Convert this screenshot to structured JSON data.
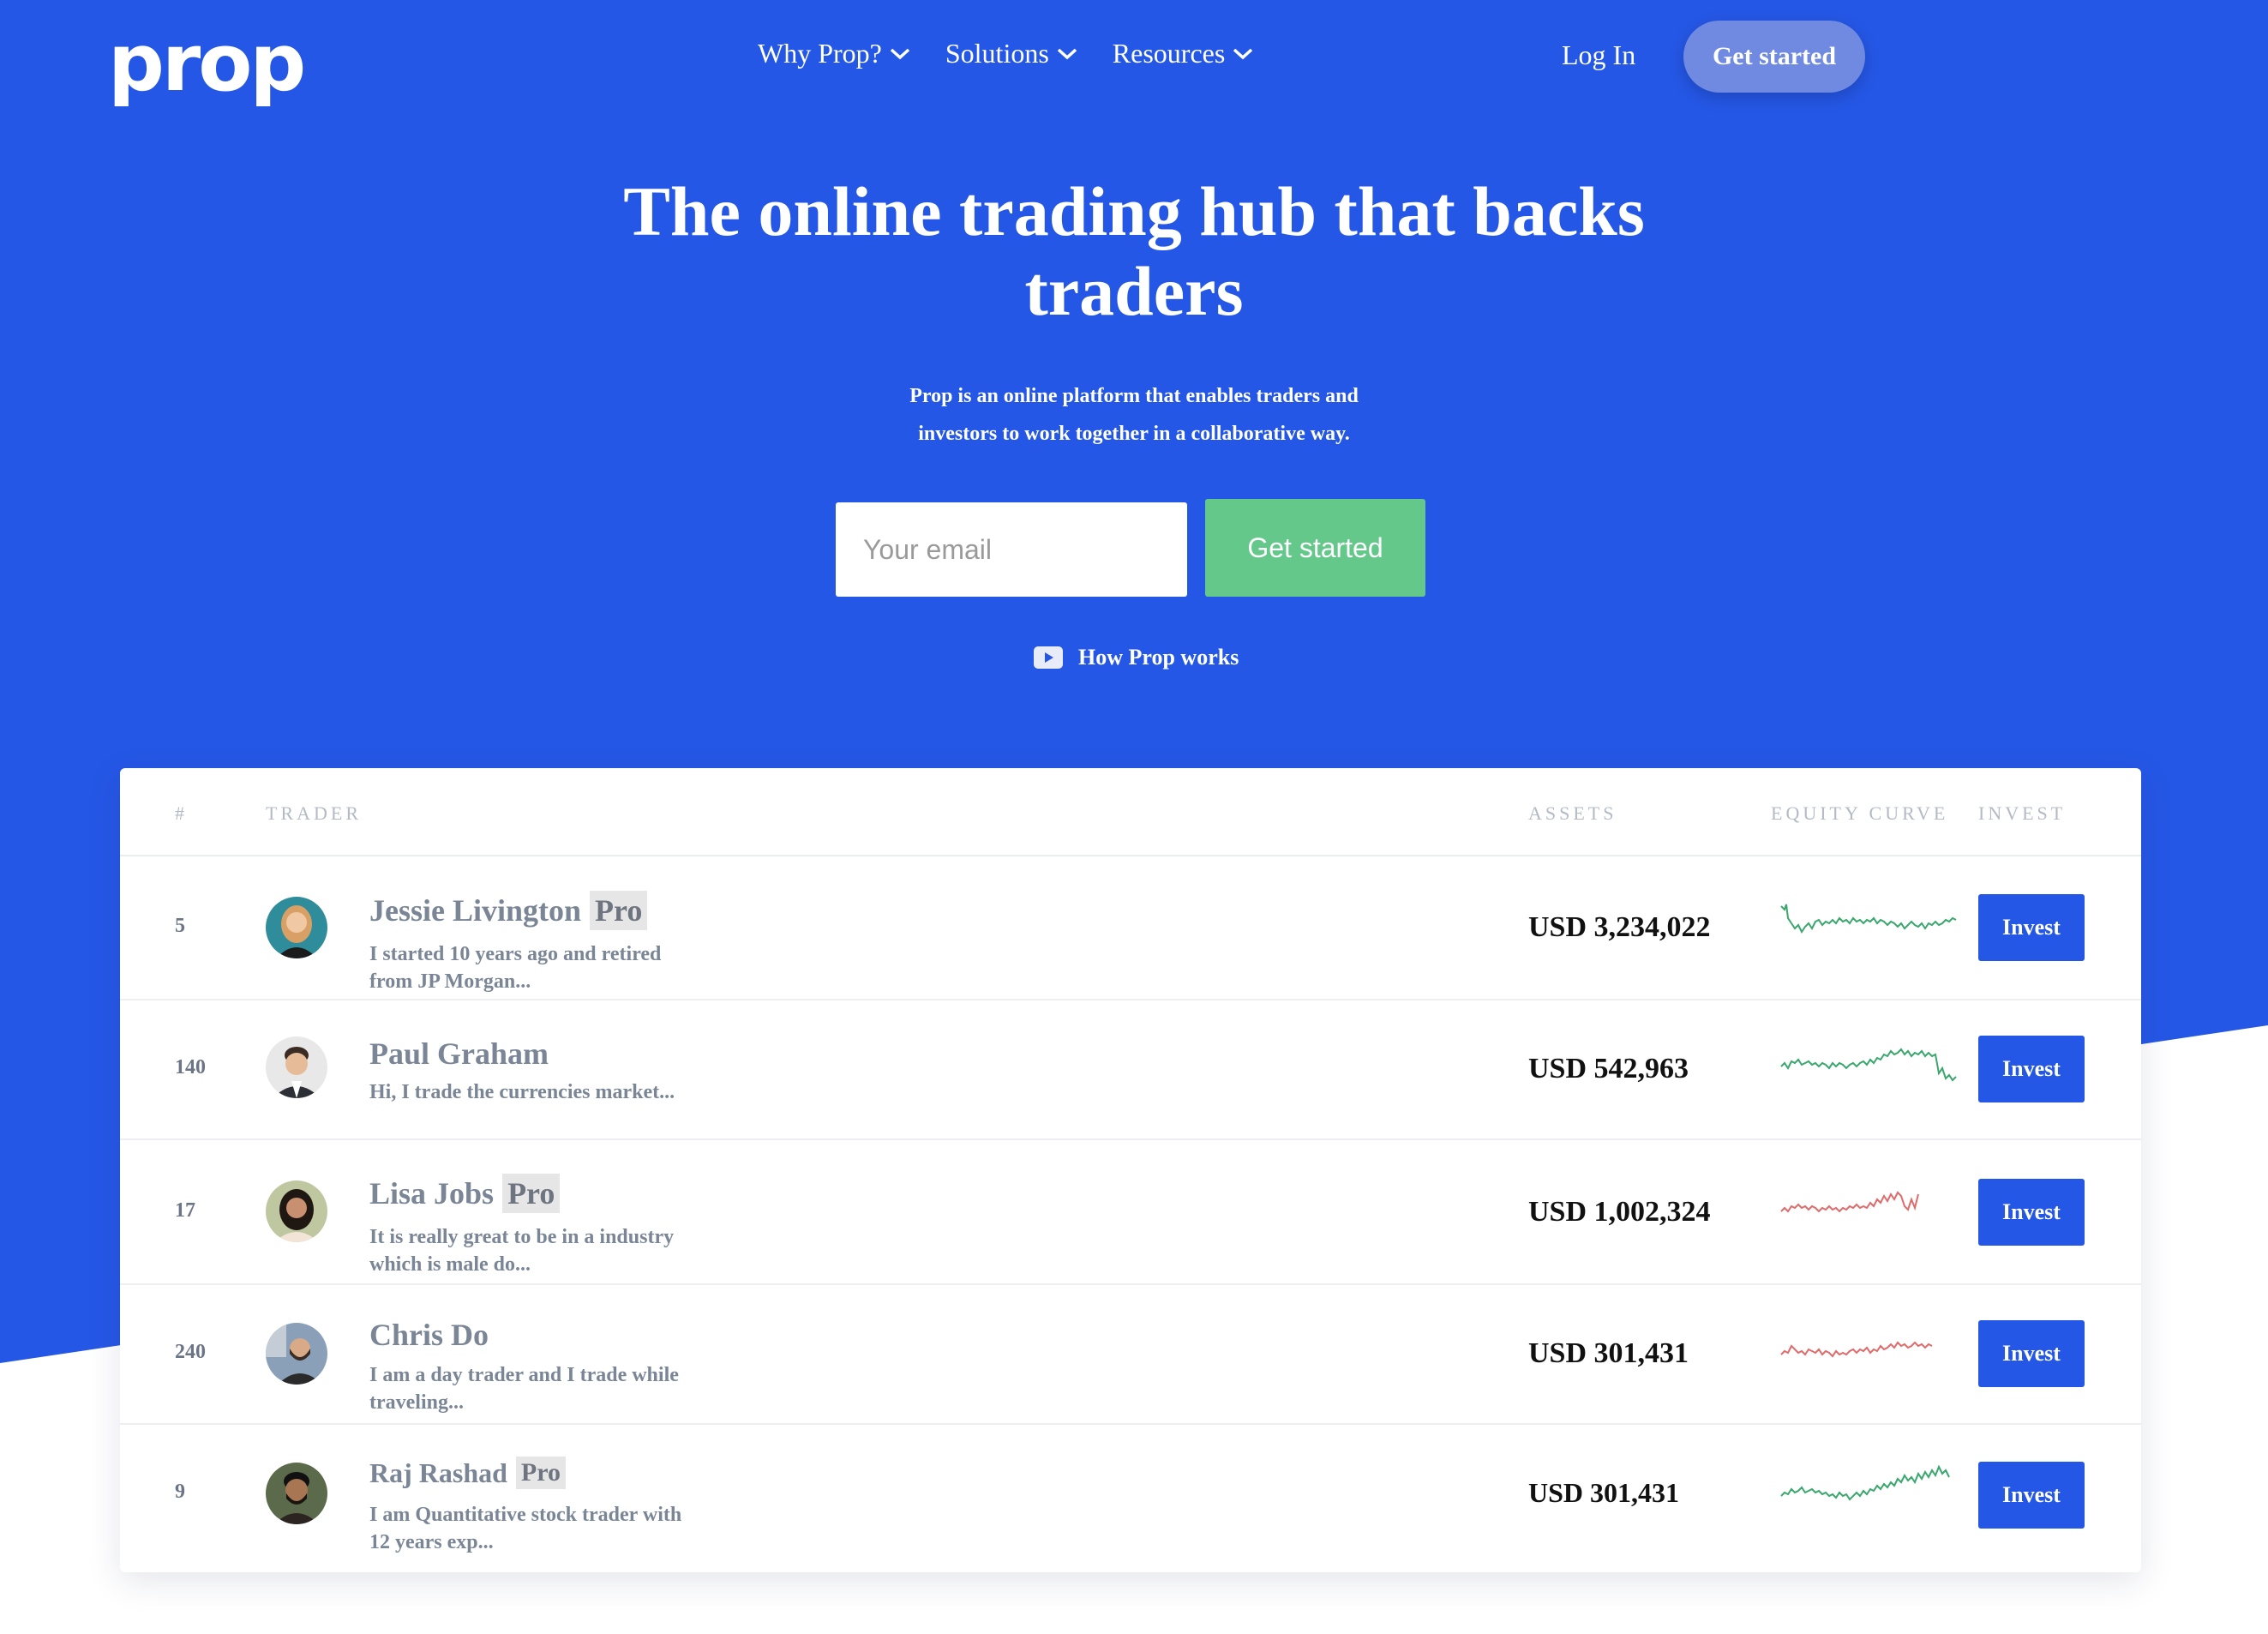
{
  "brand": {
    "logo_text": "prop",
    "primary_color": "#2557e6",
    "cta_green": "#64c88a"
  },
  "nav": {
    "items": [
      {
        "label": "Why Prop?"
      },
      {
        "label": "Solutions"
      },
      {
        "label": "Resources"
      }
    ],
    "login_label": "Log In",
    "cta_label": "Get started"
  },
  "hero": {
    "title_line1": "The online trading hub that backs",
    "title_line2": "traders",
    "subtitle_line1": "Prop is an online platform that enables traders and",
    "subtitle_line2": "investors to work together in a collaborative way.",
    "email_placeholder": "Your email",
    "cta_label": "Get started",
    "video_link_label": "How Prop works",
    "video_icon": "youtube-play-icon"
  },
  "table": {
    "columns": {
      "rank": "#",
      "trader": "TRADER",
      "assets": "ASSETS",
      "equity": "EQUITY CURVE",
      "invest": "INVEST"
    },
    "rows": [
      {
        "rank": "5",
        "name": "Jessie Livington",
        "pro": "Pro",
        "desc_line1": "I started 10 years ago and retired",
        "desc_line2": "from JP Morgan...",
        "assets": "USD 3,234,022",
        "trend": "up",
        "trend_color": "#3aa76d",
        "invest_label": "Invest"
      },
      {
        "rank": "140",
        "name": "Paul Graham",
        "pro": "",
        "desc_line1": "Hi, I trade the currencies market...",
        "desc_line2": "",
        "assets": "USD 542,963",
        "trend": "up",
        "trend_color": "#3aa76d",
        "invest_label": "Invest"
      },
      {
        "rank": "17",
        "name": "Lisa Jobs",
        "pro": "Pro",
        "desc_line1": "It is really great to be in a industry",
        "desc_line2": "which is male do...",
        "assets": "USD 1,002,324",
        "trend": "down",
        "trend_color": "#e06b6b",
        "invest_label": "Invest"
      },
      {
        "rank": "240",
        "name": "Chris Do",
        "pro": "",
        "desc_line1": "I am a day trader and I trade while",
        "desc_line2": "traveling...",
        "assets": "USD 301,431",
        "trend": "down",
        "trend_color": "#e06b6b",
        "invest_label": "Invest"
      },
      {
        "rank": "9",
        "name": "Raj Rashad",
        "pro": "Pro",
        "desc_line1": "I am Quantitative stock trader with",
        "desc_line2": "12 years exp...",
        "assets": "USD 301,431",
        "trend": "up",
        "trend_color": "#3aa76d",
        "invest_label": "Invest"
      }
    ]
  }
}
